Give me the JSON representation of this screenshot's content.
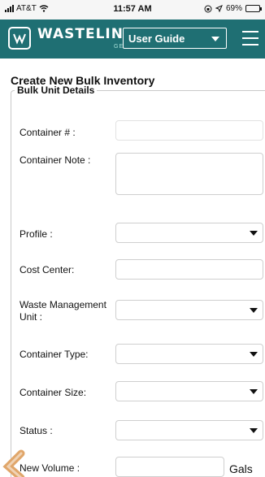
{
  "status_bar": {
    "carrier": "AT&T",
    "time": "11:57 AM",
    "battery": "69%",
    "battery_level": 0.69
  },
  "header": {
    "brand_name": "WASTELINQ",
    "brand_sub": "GENERATOR",
    "guide_select_value": "User Guide",
    "logo_icon": "wasteline-check-logo",
    "menu_icon": "hamburger-icon"
  },
  "form": {
    "title": "Create New Bulk Inventory",
    "section_legend": "Bulk Unit Details",
    "fields": {
      "container_no": {
        "label": "Container # :"
      },
      "container_note": {
        "label": "Container Note :"
      },
      "profile": {
        "label": "Profile :"
      },
      "cost_center": {
        "label": "Cost Center:"
      },
      "waste_mgmt_unit": {
        "label": "Waste Management Unit :"
      },
      "container_type": {
        "label": "Container Type:"
      },
      "container_size": {
        "label": "Container Size:"
      },
      "status": {
        "label": "Status :"
      },
      "new_volume": {
        "label": "New Volume :",
        "units": "Gals"
      }
    }
  },
  "colors": {
    "header_bg": "#1f6f73",
    "back_chevron": "#e0a66a"
  }
}
